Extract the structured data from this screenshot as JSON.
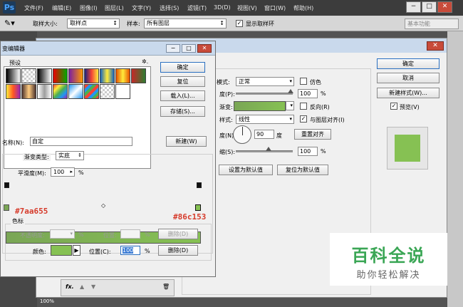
{
  "app": {
    "logo": "Ps"
  },
  "menubar": {
    "items": [
      "文件(F)",
      "编辑(E)",
      "图像(I)",
      "图层(L)",
      "文字(Y)",
      "选择(S)",
      "滤镜(T)",
      "3D(D)",
      "视图(V)",
      "窗口(W)",
      "帮助(H)"
    ],
    "win_min": "−",
    "win_max": "□",
    "win_close": "✕"
  },
  "options": {
    "sample_size_label": "取样大小:",
    "sample_size_value": "取样点",
    "sample_label": "样本:",
    "sample_value": "所有图层",
    "show_ring_label": "显示取样环",
    "workspace": "基本功能"
  },
  "layer_style": {
    "blend_mode_label": "模式:",
    "blend_mode_value": "正常",
    "dither_label": "仿色",
    "opacity_label": "度(P):",
    "opacity_value": "100",
    "gradient_label": "渐变:",
    "reverse_label": "反向(R)",
    "style_label": "样式:",
    "style_value": "线性",
    "align_label": "与图层对齐(I)",
    "angle_label": "度(N):",
    "angle_value": "90",
    "angle_unit": "度",
    "reset_align": "重置对齐",
    "scale_label": "缩(S):",
    "scale_value": "100",
    "pct": "%",
    "set_default": "设置为默认值",
    "reset_default": "复位为默认值",
    "ok": "确定",
    "cancel": "取消",
    "new_style": "新建样式(W)...",
    "preview_label": "预览(V)"
  },
  "gradient_editor": {
    "title": "变编辑器",
    "presets_label": "预设",
    "gear": "✲.",
    "ok": "确定",
    "reset": "复位",
    "load": "载入(L)...",
    "save": "存储(S)...",
    "name_label": "名称(N):",
    "name_value": "自定",
    "new_btn": "新建(W)",
    "type_label": "渐变类型:",
    "type_value": "实底",
    "smooth_label": "平滑度(M):",
    "smooth_value": "100",
    "pct": "%",
    "left_color_hex": "#7aa655",
    "right_color_hex": "#86c153",
    "stops_label": "色标",
    "opacity_label": "不透明度:",
    "location_label": "位置:",
    "delete_btn": "删除(D)",
    "color_label": "颜色:",
    "location_c_label": "位置(C):",
    "location_c_value": "100",
    "stop_color": "#86c153"
  },
  "layers_panel": {
    "fx": "fx.",
    "zoom": "100%"
  },
  "watermark": {
    "main": "百科全说",
    "sub": "助你轻松解决"
  },
  "colors": {
    "gradient_start": "#7aa655",
    "gradient_end": "#86c153",
    "preview_fill": "#86c153",
    "watermark_green": "#3aa655"
  }
}
